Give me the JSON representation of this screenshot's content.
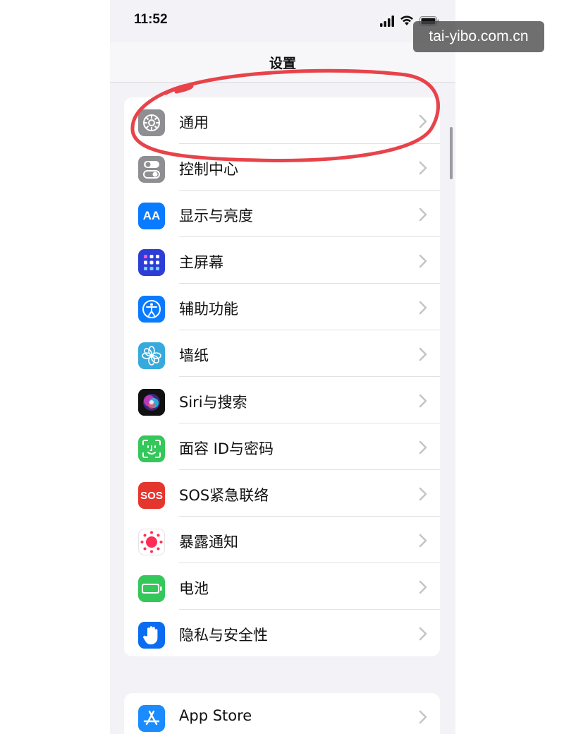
{
  "status_bar": {
    "time": "11:52"
  },
  "nav": {
    "title": "设置"
  },
  "watermark": "tai-yibo.com.cn",
  "settings_group_1": [
    {
      "label": "通用",
      "icon": "gear-icon",
      "color": "#8e8e93"
    },
    {
      "label": "控制中心",
      "icon": "toggle-icon",
      "color": "#8e8e93"
    },
    {
      "label": "显示与亮度",
      "icon": "aa-text-icon",
      "icon_text": "AA",
      "color": "#0a7aff"
    },
    {
      "label": "主屏幕",
      "icon": "home-grid-icon",
      "color": "#2c3ed6"
    },
    {
      "label": "辅助功能",
      "icon": "accessibility-icon",
      "color": "#0a7aff"
    },
    {
      "label": "墙纸",
      "icon": "flower-icon",
      "color": "#36aadc"
    },
    {
      "label": "Siri与搜索",
      "icon": "siri-icon",
      "color": "#111111"
    },
    {
      "label": "面容 ID与密码",
      "icon": "face-id-icon",
      "color": "#34c759"
    },
    {
      "label": "SOS紧急联络",
      "icon": "sos-icon",
      "icon_text": "SOS",
      "color": "#e5362e"
    },
    {
      "label": "暴露通知",
      "icon": "exposure-icon",
      "color": "#ffffff"
    },
    {
      "label": "电池",
      "icon": "battery-icon",
      "color": "#34c759"
    },
    {
      "label": "隐私与安全性",
      "icon": "hand-icon",
      "color": "#0a6cf0"
    }
  ],
  "settings_group_2": [
    {
      "label": "App Store",
      "icon": "app-store-icon",
      "color": "#1a8cff"
    }
  ],
  "colors": {
    "background": "#f2f2f7",
    "annotation": "#e8434a",
    "chevron": "#c4c4c7"
  }
}
